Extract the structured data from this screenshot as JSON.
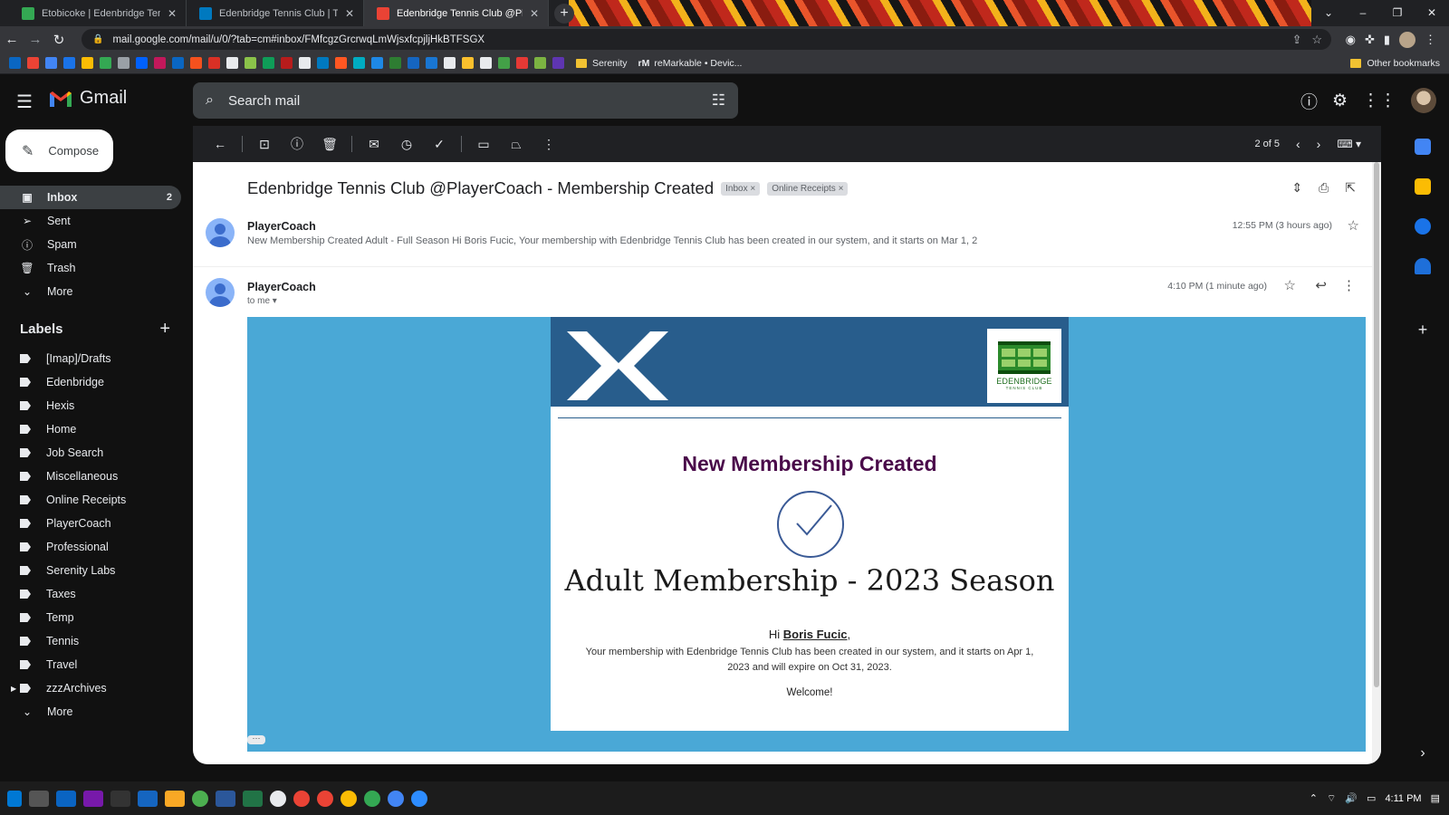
{
  "browser": {
    "tabs": [
      {
        "title": "Etobicoke | Edenbridge Tennis Cl",
        "favicon_color": "#34a853"
      },
      {
        "title": "Edenbridge Tennis Club | Trello",
        "favicon_color": "#0079bf"
      },
      {
        "title": "Edenbridge Tennis Club @Player",
        "favicon_color": "#ea4335"
      }
    ],
    "url": "mail.google.com/mail/u/0/?tab=cm#inbox/FMfcgzGrcrwqLmWjsxfcpjljHkBTFSGX",
    "bookmarks": {
      "serenity": "Serenity",
      "remarkable": "reMarkable • Devic...",
      "other": "Other bookmarks"
    }
  },
  "gmail": {
    "brand": "Gmail",
    "search_placeholder": "Search mail",
    "compose": "Compose",
    "nav": [
      {
        "label": "Inbox",
        "count": "2",
        "icon": "inbox-icon"
      },
      {
        "label": "Sent",
        "count": "",
        "icon": "send-icon"
      },
      {
        "label": "Spam",
        "count": "",
        "icon": "spam-icon"
      },
      {
        "label": "Trash",
        "count": "",
        "icon": "trash-icon"
      },
      {
        "label": "More",
        "count": "",
        "icon": "chevron-down-icon"
      }
    ],
    "labels_title": "Labels",
    "labels": [
      "[Imap]/Drafts",
      "Edenbridge",
      "Hexis",
      "Home",
      "Job Search",
      "Miscellaneous",
      "Online Receipts",
      "PlayerCoach",
      "Professional",
      "Serenity Labs",
      "Taxes",
      "Temp",
      "Tennis",
      "Travel",
      "zzzArchives",
      "More"
    ],
    "pagination": "2 of 5"
  },
  "thread": {
    "subject": "Edenbridge Tennis Club @PlayerCoach - Membership Created",
    "chips": [
      "Inbox",
      "Online Receipts"
    ],
    "messages": [
      {
        "sender": "PlayerCoach",
        "time": "12:55 PM (3 hours ago)",
        "snippet": "New Membership Created Adult - Full Season Hi Boris Fucic, Your membership with Edenbridge Tennis Club has been created in our system, and it starts on Mar 1, 2"
      },
      {
        "sender": "PlayerCoach",
        "time": "4:10 PM (1 minute ago)",
        "to": "to me"
      }
    ]
  },
  "email": {
    "club_logo_text": "EDENBRIDGE",
    "club_logo_sub": "TENNIS CLUB",
    "heading": "New Membership Created",
    "title": "Adult Membership - 2023 Season",
    "greeting_prefix": "Hi",
    "greeting_name": "Boris Fucic",
    "greeting_suffix": ",",
    "body": "Your membership with Edenbridge Tennis Club has been created in our system, and it starts on Apr 1, 2023 and will expire on Oct 31, 2023.",
    "closing": "Welcome!"
  },
  "taskbar": {
    "time": "4:11 PM"
  },
  "colors": {
    "header_blue": "#285d8c",
    "body_blue": "#4aa8d6",
    "heading_purple": "#4a0a4a",
    "club_green": "#2b8a2b"
  }
}
